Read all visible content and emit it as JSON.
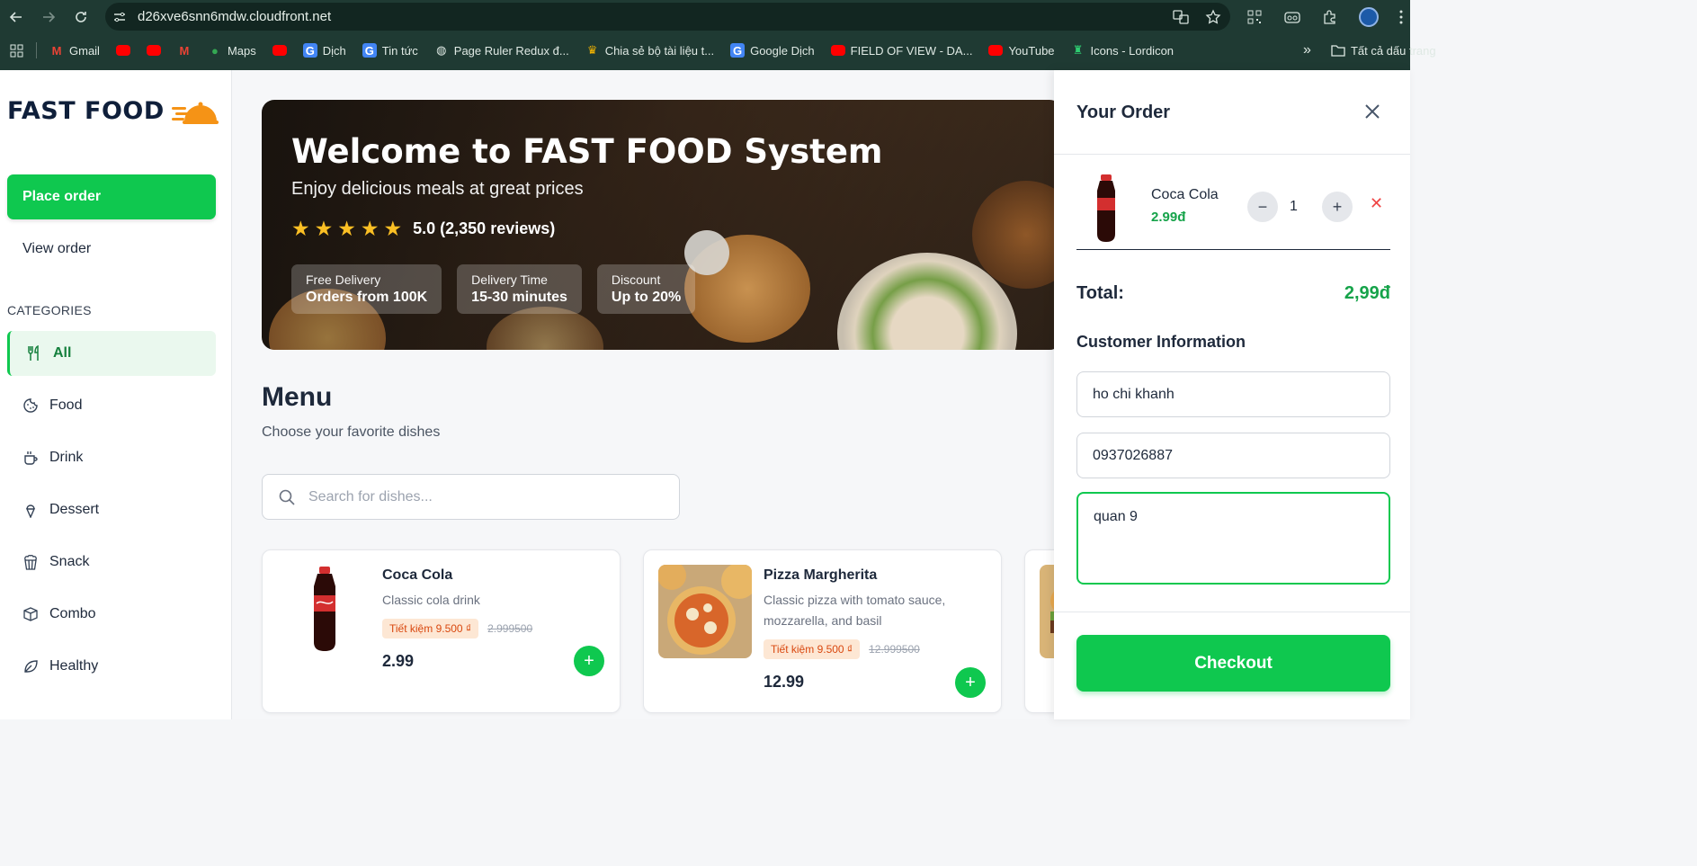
{
  "browser": {
    "url": "d26xve6snn6mdw.cloudfront.net",
    "bookmarks": [
      {
        "label": "Gmail",
        "icon": "gmail-icon"
      },
      {
        "label": "",
        "icon": "youtube-icon"
      },
      {
        "label": "",
        "icon": "youtube-icon"
      },
      {
        "label": "",
        "icon": "gmail-icon"
      },
      {
        "label": "Maps",
        "icon": "maps-icon"
      },
      {
        "label": "",
        "icon": "youtube-icon"
      },
      {
        "label": "Dịch",
        "icon": "translate-icon"
      },
      {
        "label": "Tin tức",
        "icon": "news-icon"
      },
      {
        "label": "Page Ruler Redux đ...",
        "icon": "globe-icon"
      },
      {
        "label": "Chia sẻ bộ tài liệu t...",
        "icon": "crown-icon"
      },
      {
        "label": "Google Dịch",
        "icon": "translate-icon"
      },
      {
        "label": "FIELD OF VIEW - DA...",
        "icon": "youtube-icon"
      },
      {
        "label": "YouTube",
        "icon": "youtube-icon"
      },
      {
        "label": "Icons - Lordicon",
        "icon": "lordicon-icon"
      }
    ],
    "more": "»",
    "all_bookmarks": "Tất cả dấu trang"
  },
  "sidebar": {
    "logo": "FAST FOOD",
    "place_order": "Place order",
    "view_order": "View order",
    "categories_heading": "CATEGORIES",
    "categories": [
      {
        "label": "All",
        "icon": "utensils-icon"
      },
      {
        "label": "Food",
        "icon": "cookie-icon"
      },
      {
        "label": "Drink",
        "icon": "cup-icon"
      },
      {
        "label": "Dessert",
        "icon": "icecream-icon"
      },
      {
        "label": "Snack",
        "icon": "popcorn-icon"
      },
      {
        "label": "Combo",
        "icon": "package-icon"
      },
      {
        "label": "Healthy",
        "icon": "leaf-icon"
      }
    ]
  },
  "hero": {
    "title": "Welcome to FAST FOOD System",
    "subtitle": "Enjoy delicious meals at great prices",
    "rating": "5.0 (2,350 reviews)",
    "badges": [
      {
        "title": "Free Delivery",
        "value": "Orders from 100K"
      },
      {
        "title": "Delivery Time",
        "value": "15-30 minutes"
      },
      {
        "title": "Discount",
        "value": "Up to 20%"
      }
    ]
  },
  "menu": {
    "title": "Menu",
    "subtitle": "Choose your favorite dishes",
    "search_placeholder": "Search for dishes...",
    "items": [
      {
        "name": "Coca Cola",
        "desc": "Classic cola drink",
        "save": "Tiết kiệm 9.500 ₫",
        "old": "2.999500",
        "price": "2.99"
      },
      {
        "name": "Pizza Margherita",
        "desc": "Classic pizza with tomato sauce, mozzarella, and basil",
        "save": "Tiết kiệm 9.500 ₫",
        "old": "12.999500",
        "price": "12.99"
      }
    ]
  },
  "order": {
    "title": "Your Order",
    "item": {
      "name": "Coca Cola",
      "price": "2.99đ",
      "qty": "1"
    },
    "total_label": "Total:",
    "total_value": "2,99đ",
    "customer_heading": "Customer Information",
    "name": "ho chi khanh",
    "phone": "0937026887",
    "address": "quan 9",
    "checkout": "Checkout"
  },
  "colors": {
    "accent": "#0fc84f",
    "price_green": "#16a34a",
    "chrome": "#1f3a33"
  }
}
